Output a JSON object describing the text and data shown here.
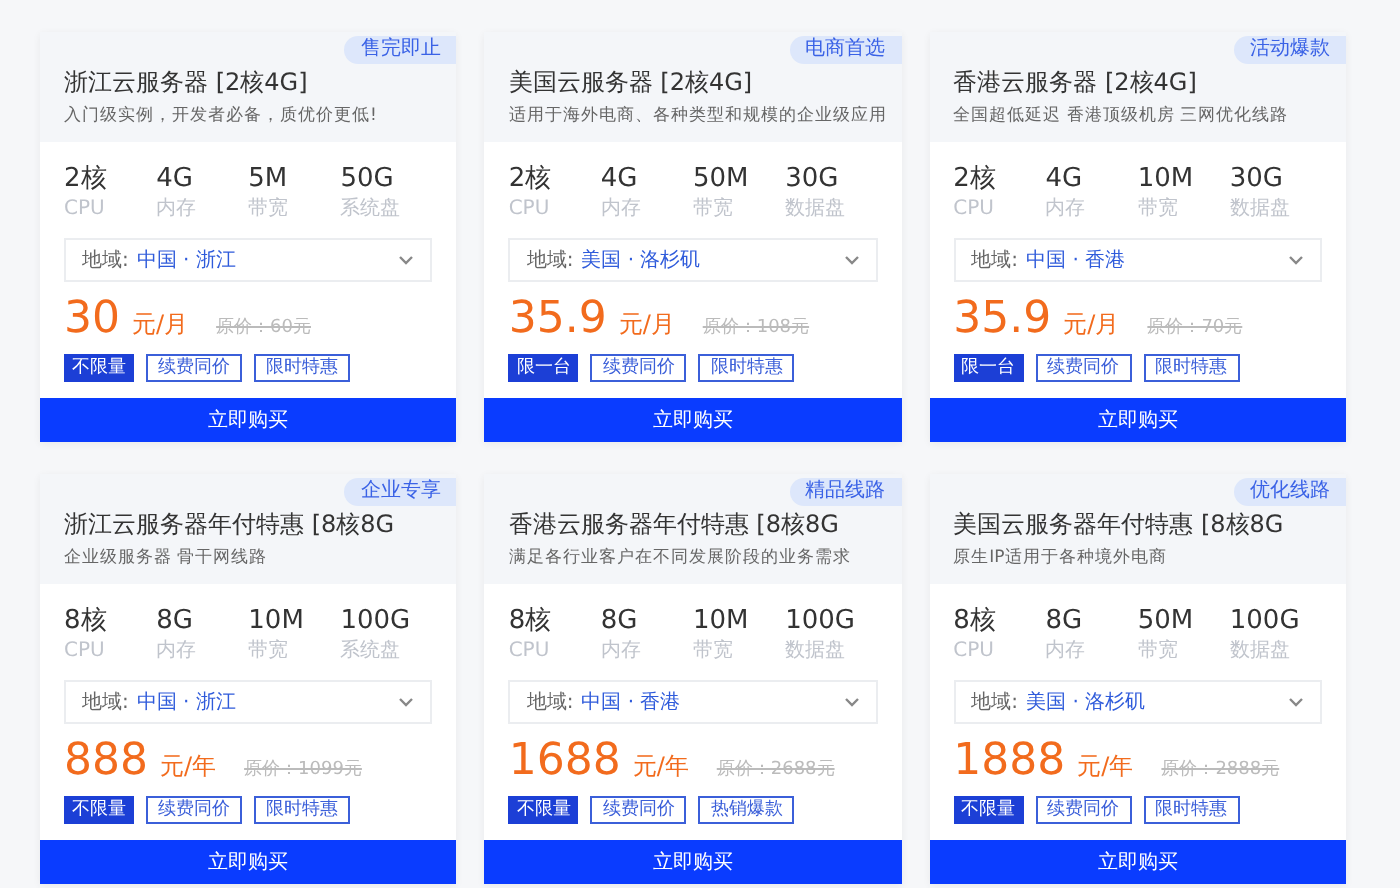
{
  "cards": [
    {
      "title": "浙江云服务器 [2核4G]",
      "badge": "售完即止",
      "subtitle": "入门级实例，开发者必备，质优价更低!",
      "specs": [
        {
          "value": "2核",
          "label": "CPU"
        },
        {
          "value": "4G",
          "label": "内存"
        },
        {
          "value": "5M",
          "label": "带宽"
        },
        {
          "value": "50G",
          "label": "系统盘"
        }
      ],
      "region_label": "地域:",
      "region": "中国 · 浙江",
      "price": "30",
      "unit": "元/月",
      "original_price": "原价：60元",
      "tags": [
        {
          "text": "不限量",
          "filled": true
        },
        {
          "text": "续费同价",
          "filled": false
        },
        {
          "text": "限时特惠",
          "filled": false
        }
      ],
      "button": "立即购买"
    },
    {
      "title": "美国云服务器 [2核4G]",
      "badge": "电商首选",
      "subtitle": "适用于海外电商、各种类型和规模的企业级应用",
      "specs": [
        {
          "value": "2核",
          "label": "CPU"
        },
        {
          "value": "4G",
          "label": "内存"
        },
        {
          "value": "50M",
          "label": "带宽"
        },
        {
          "value": "30G",
          "label": "数据盘"
        }
      ],
      "region_label": "地域:",
      "region": "美国 · 洛杉矶",
      "price": "35.9",
      "unit": "元/月",
      "original_price": "原价：108元",
      "tags": [
        {
          "text": "限一台",
          "filled": true
        },
        {
          "text": "续费同价",
          "filled": false
        },
        {
          "text": "限时特惠",
          "filled": false
        }
      ],
      "button": "立即购买"
    },
    {
      "title": "香港云服务器 [2核4G]",
      "badge": "活动爆款",
      "subtitle": "全国超低延迟 香港顶级机房 三网优化线路",
      "specs": [
        {
          "value": "2核",
          "label": "CPU"
        },
        {
          "value": "4G",
          "label": "内存"
        },
        {
          "value": "10M",
          "label": "带宽"
        },
        {
          "value": "30G",
          "label": "数据盘"
        }
      ],
      "region_label": "地域:",
      "region": "中国 · 香港",
      "price": "35.9",
      "unit": "元/月",
      "original_price": "原价：70元",
      "tags": [
        {
          "text": "限一台",
          "filled": true
        },
        {
          "text": "续费同价",
          "filled": false
        },
        {
          "text": "限时特惠",
          "filled": false
        }
      ],
      "button": "立即购买"
    },
    {
      "title": "浙江云服务器年付特惠 [8核8G",
      "badge": "企业专享",
      "subtitle": "企业级服务器 骨干网线路",
      "specs": [
        {
          "value": "8核",
          "label": "CPU"
        },
        {
          "value": "8G",
          "label": "内存"
        },
        {
          "value": "10M",
          "label": "带宽"
        },
        {
          "value": "100G",
          "label": "系统盘"
        }
      ],
      "region_label": "地域:",
      "region": "中国 · 浙江",
      "price": "888",
      "unit": "元/年",
      "original_price": "原价：1099元",
      "tags": [
        {
          "text": "不限量",
          "filled": true
        },
        {
          "text": "续费同价",
          "filled": false
        },
        {
          "text": "限时特惠",
          "filled": false
        }
      ],
      "button": "立即购买"
    },
    {
      "title": "香港云服务器年付特惠 [8核8G",
      "badge": "精品线路",
      "subtitle": "满足各行业客户在不同发展阶段的业务需求",
      "specs": [
        {
          "value": "8核",
          "label": "CPU"
        },
        {
          "value": "8G",
          "label": "内存"
        },
        {
          "value": "10M",
          "label": "带宽"
        },
        {
          "value": "100G",
          "label": "数据盘"
        }
      ],
      "region_label": "地域:",
      "region": "中国 · 香港",
      "price": "1688",
      "unit": "元/年",
      "original_price": "原价：2688元",
      "tags": [
        {
          "text": "不限量",
          "filled": true
        },
        {
          "text": "续费同价",
          "filled": false
        },
        {
          "text": "热销爆款",
          "filled": false
        }
      ],
      "button": "立即购买"
    },
    {
      "title": "美国云服务器年付特惠 [8核8G",
      "badge": "优化线路",
      "subtitle": "原生IP适用于各种境外电商",
      "specs": [
        {
          "value": "8核",
          "label": "CPU"
        },
        {
          "value": "8G",
          "label": "内存"
        },
        {
          "value": "50M",
          "label": "带宽"
        },
        {
          "value": "100G",
          "label": "数据盘"
        }
      ],
      "region_label": "地域:",
      "region": "美国 · 洛杉矶",
      "price": "1888",
      "unit": "元/年",
      "original_price": "原价：2888元",
      "tags": [
        {
          "text": "不限量",
          "filled": true
        },
        {
          "text": "续费同价",
          "filled": false
        },
        {
          "text": "限时特惠",
          "filled": false
        }
      ],
      "button": "立即购买"
    }
  ]
}
